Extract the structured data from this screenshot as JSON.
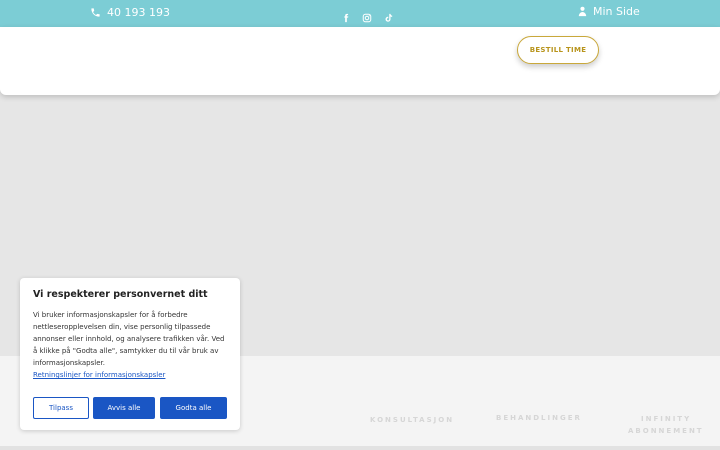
{
  "topbar": {
    "phone": "40 193 193",
    "social_icons": [
      "facebook-icon",
      "instagram-icon",
      "tiktok-icon"
    ],
    "min_side": "Min Side"
  },
  "header": {
    "bestill_button": "BESTILL TIME"
  },
  "footer": {
    "links": [
      "KONSULTASJON",
      "BEHANDLINGER",
      "INFINITY",
      "ABONNEMENT"
    ]
  },
  "cookie": {
    "title": "Vi respekterer personvernet ditt",
    "body": "Vi bruker informasjonskapsler for å forbedre nettleseropplevelsen din, vise personlig tilpassede annonser eller innhold, og analysere trafikken vår. Ved å klikke på \"Godta alle\", samtykker du til vår bruk av informasjonskapsler.",
    "policy_link": "Retningslinjer for informasjonskapsler",
    "customize_button": "Tilpass",
    "reject_button": "Avvis alle",
    "accept_button": "Godta alle"
  },
  "colors": {
    "topbar": "#7ccdd5",
    "accent_gold": "#c9a83a",
    "primary_blue": "#1a56c4"
  }
}
